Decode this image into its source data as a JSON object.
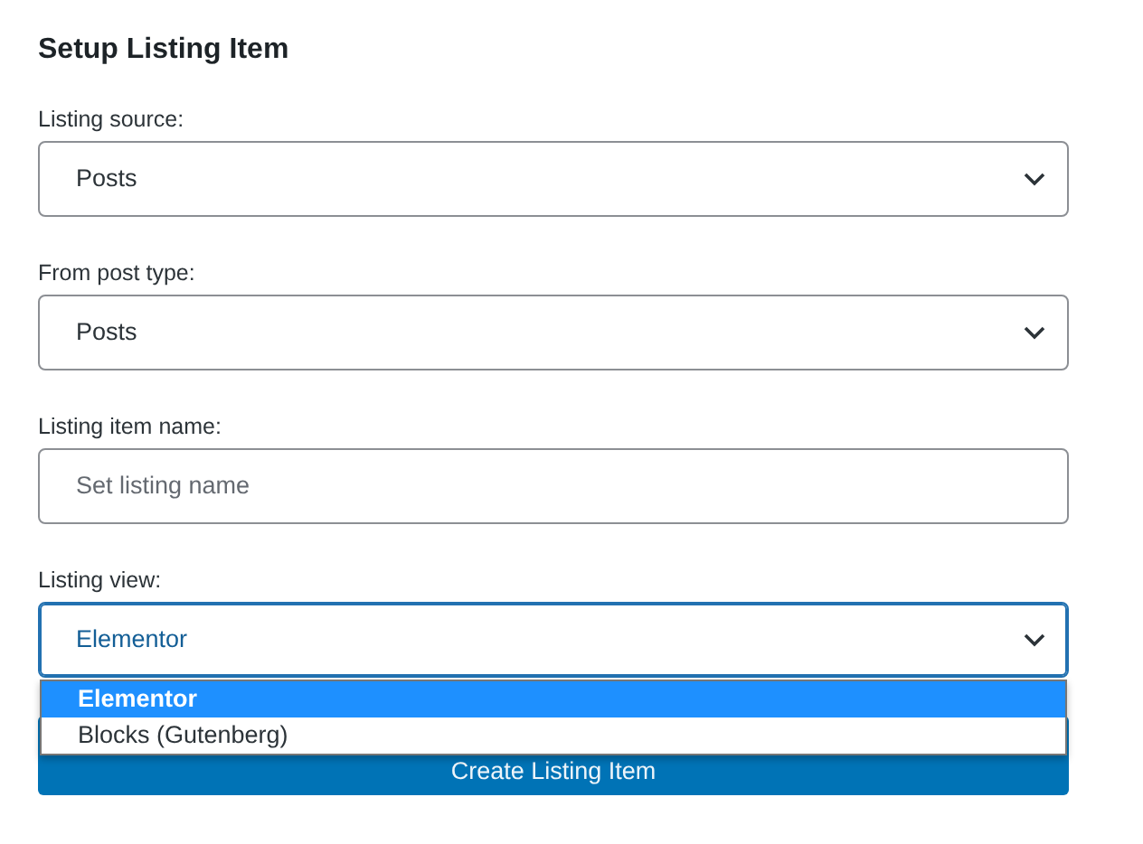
{
  "title": "Setup Listing Item",
  "fields": [
    {
      "kind": "select",
      "label": "Listing source:",
      "value": "Posts",
      "expanded": false
    },
    {
      "kind": "select",
      "label": "From post type:",
      "value": "Posts",
      "expanded": false
    },
    {
      "kind": "text",
      "label": "Listing item name:",
      "placeholder": "Set listing name"
    },
    {
      "kind": "select",
      "label": "Listing view:",
      "value": "Elementor",
      "expanded": true,
      "options": [
        {
          "label": "Elementor",
          "selected": true
        },
        {
          "label": "Blocks (Gutenberg)",
          "selected": false
        }
      ]
    }
  ],
  "submit": "Create Listing Item"
}
